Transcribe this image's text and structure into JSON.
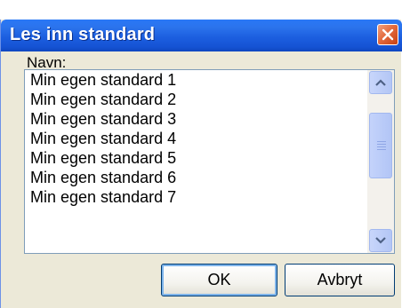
{
  "dialog": {
    "title": "Les inn standard",
    "close_icon": "close-icon",
    "name_label": "Navn:",
    "items": [
      "Min egen standard 1",
      "Min egen standard 2",
      "Min egen standard 3",
      "Min egen standard 4",
      "Min egen standard 5",
      "Min egen standard 6",
      "Min egen standard 7"
    ],
    "ok_label": "OK",
    "cancel_label": "Avbryt"
  },
  "colors": {
    "titlebar": "#1c5fe0",
    "close_button": "#e36b3f",
    "dialog_background": "#ece9d8",
    "scrollbar": "#b3c6f5"
  }
}
